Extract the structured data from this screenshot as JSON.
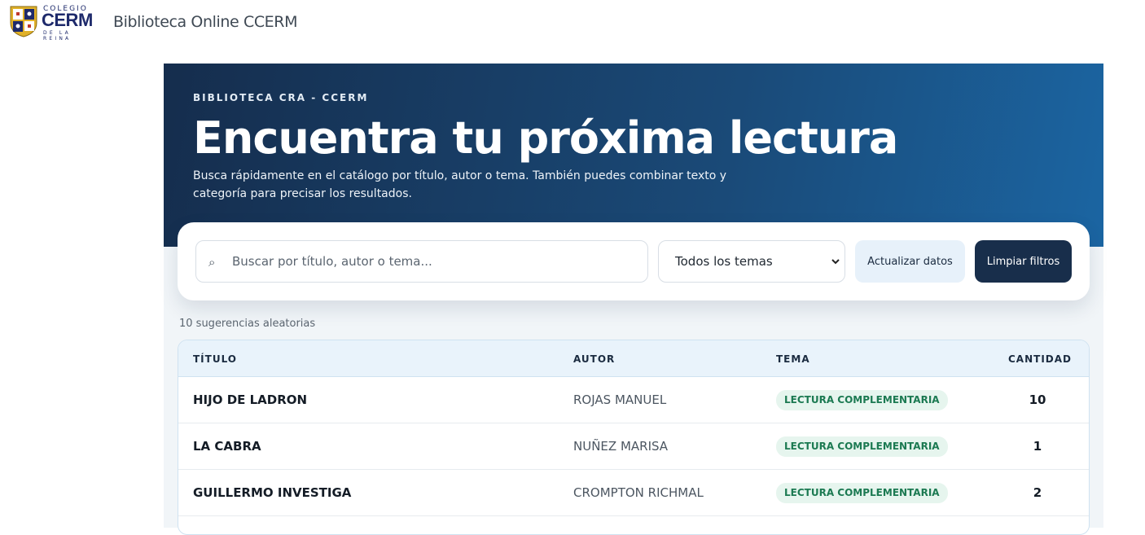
{
  "header": {
    "logo": {
      "colegio": "COLEGIO",
      "cerm": "CERM",
      "reina": "DE LA REINA"
    },
    "site_title": "Biblioteca Online CCERM"
  },
  "hero": {
    "eyebrow": "BIBLIOTECA CRA - CCERM",
    "title": "Encuentra tu próxima lectura",
    "description": "Busca rápidamente en el catálogo por título, autor o tema. También puedes combinar texto y categoría para precisar los resultados."
  },
  "search": {
    "icon": "search-icon",
    "placeholder": "Buscar por título, autor o tema...",
    "value": "",
    "theme_selected": "Todos los temas",
    "refresh_label": "Actualizar datos",
    "clear_label": "Limpiar filtros"
  },
  "results": {
    "count_label": "10 sugerencias aleatorias",
    "columns": [
      "TÍTULO",
      "AUTOR",
      "TEMA",
      "CANTIDAD"
    ],
    "rows": [
      {
        "title": "HIJO DE LADRON",
        "author": "ROJAS MANUEL",
        "theme": "LECTURA COMPLEMENTARIA",
        "qty": "10"
      },
      {
        "title": "LA CABRA",
        "author": "NUÑEZ MARISA",
        "theme": "LECTURA COMPLEMENTARIA",
        "qty": "1"
      },
      {
        "title": "GUILLERMO INVESTIGA",
        "author": "CROMPTON RICHMAL",
        "theme": "LECTURA COMPLEMENTARIA",
        "qty": "2"
      }
    ]
  },
  "colors": {
    "hero_start": "#152d4d",
    "hero_end": "#1b65a2",
    "primary_button": "#182e4b",
    "secondary_button": "#e7f1fa",
    "tag_bg": "#e6f5ee",
    "tag_text": "#1c7a52"
  }
}
